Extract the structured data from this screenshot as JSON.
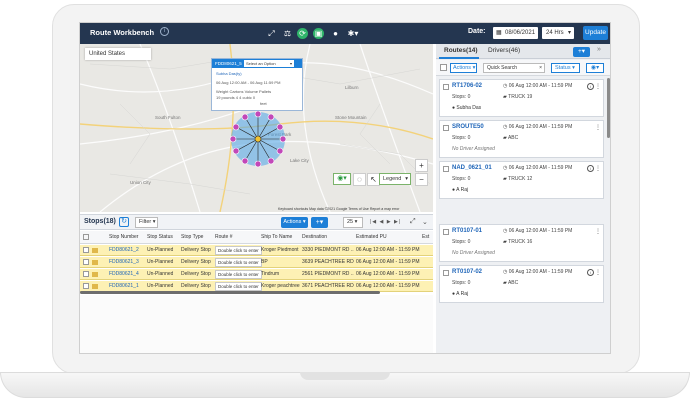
{
  "header": {
    "title": "Route Workbench",
    "info_icon": "i",
    "date_label": "Date:",
    "date_value": "08/06/2021",
    "hours_value": "24 Hrs",
    "update_label": "Update"
  },
  "map": {
    "search_value": "United States",
    "popup": {
      "stop_id": "FDD80621_5",
      "select_placeholder": "Select an Option",
      "name": "Subha Das(ty)",
      "time_range": "06 Aug 12:00 AM - 06 Aug 11:59 PM",
      "labels": "Weight  Cartons  Volume  Pallets",
      "values": "19 pounds  4  4 cubic  0",
      "extra": "feet"
    },
    "legend_label": "Legend",
    "attribution": "Keyboard shortcuts   Map data ©2021 Google   Terms of Use   Report a map error"
  },
  "stops": {
    "title": "Stops(18)",
    "filter_label": "Filter",
    "actions_label": "Actions",
    "page_size": "25",
    "columns": [
      "Stop Number",
      "Stop Status",
      "Stop Type",
      "Route #",
      "Ship To Name",
      "Destination",
      "Estimated PU",
      "Est"
    ],
    "rows": [
      {
        "stop": "FDD80621_2",
        "status": "Un-Planned",
        "type": "Delivery Stop",
        "route": "Double click to enter",
        "ship_to": "Kroger Piedmont",
        "destination": "3330 PIEDMONT RD ...",
        "est_pu": "06 Aug 12:00 AM - 11:59 PM"
      },
      {
        "stop": "FDD80621_3",
        "status": "Un-Planned",
        "type": "Delivery Stop",
        "route": "Double click to enter",
        "ship_to": "BP",
        "destination": "3639 PEACHTREE RD...",
        "est_pu": "06 Aug 12:00 AM - 11:59 PM"
      },
      {
        "stop": "FDD80621_4",
        "status": "Un-Planned",
        "type": "Delivery Stop",
        "route": "Double click to enter",
        "ship_to": "Tindrum",
        "destination": "2561 PIEDMONT RD ...",
        "est_pu": "06 Aug 12:00 AM - 11:59 PM"
      },
      {
        "stop": "FDD80621_1",
        "status": "Un-Planned",
        "type": "Delivery Stop",
        "route": "Double click to enter",
        "ship_to": "Kroger peachtree",
        "destination": "3671 PEACHTREE RD...",
        "est_pu": "06 Aug 12:00 AM - 11:59 PM"
      }
    ]
  },
  "routes_panel": {
    "tab_routes": "Routes(14)",
    "tab_drivers": "Drivers(46)",
    "actions_label": "Actions",
    "search_placeholder": "Quick Search",
    "status_label": "Status",
    "routes": [
      {
        "id": "RT1706-02",
        "time": "06 Aug 12:00 AM - 11:59 PM",
        "stops": "Stops: 0",
        "truck": "TRUCK 19",
        "driver": "Subha Das",
        "assigned": true
      },
      {
        "id": "SROUTE50",
        "time": "06 Aug 12:00 AM - 11:59 PM",
        "stops": "Stops: 0",
        "truck": "ABC",
        "driver": "No Driver Assigned",
        "assigned": false
      },
      {
        "id": "NAD_0621_01",
        "time": "06 Aug 12:00 AM - 11:59 PM",
        "stops": "Stops: 0",
        "truck": "TRUCK 12",
        "driver": "A Raj",
        "assigned": true
      },
      {
        "id": "RT0107-01",
        "time": "06 Aug 12:00 AM - 11:59 PM",
        "stops": "Stops: 0",
        "truck": "TRUCK 16",
        "driver": "No Driver Assigned",
        "assigned": false
      },
      {
        "id": "RT0107-02",
        "time": "06 Aug 12:00 AM - 11:59 PM",
        "stops": "Stops: 0",
        "truck": "ABC",
        "driver": "A Raj",
        "assigned": true
      }
    ]
  },
  "colors": {
    "header_bg": "#243650",
    "accent": "#1d7fd7",
    "row_highlight": "#fdf1b4",
    "cluster": "#4aa3e8",
    "stop_marker": "#c248b8"
  }
}
